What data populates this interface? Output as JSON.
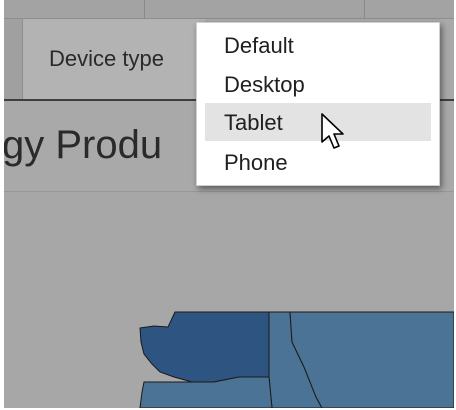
{
  "toolbar": {
    "device_type_label": "Device type"
  },
  "dashboard": {
    "title_partial": "gy Produ"
  },
  "device_menu": {
    "items": [
      {
        "label": "Default",
        "highlighted": false
      },
      {
        "label": "Desktop",
        "highlighted": false
      },
      {
        "label": "Tablet",
        "highlighted": true
      },
      {
        "label": "Phone",
        "highlighted": false
      }
    ]
  },
  "colors": {
    "map_dark": "#2e5482",
    "map_medium": "#4a7395",
    "highlight": "#e3e3e3"
  },
  "icons": {
    "cursor": "mouse-pointer-icon"
  }
}
